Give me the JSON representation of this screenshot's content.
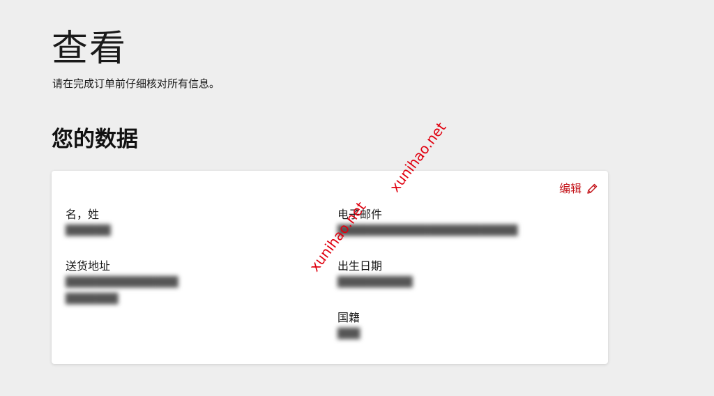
{
  "header": {
    "title": "查看",
    "subtitle": "请在完成订单前仔细核对所有信息。"
  },
  "section": {
    "title": "您的数据"
  },
  "card": {
    "edit_label": "编辑",
    "edit_icon": "pencil-icon",
    "fields": {
      "name": {
        "label": "名，姓",
        "value": "██████"
      },
      "address": {
        "label": "送货地址",
        "line1": "███████████████",
        "line2": "███████"
      },
      "email": {
        "label": "电子邮件",
        "value": "████████████████████████"
      },
      "birthdate": {
        "label": "出生日期",
        "value": "██████████"
      },
      "nationality": {
        "label": "国籍",
        "value": "███"
      }
    }
  },
  "watermarks": {
    "upper": "xunihao.net",
    "lower": "xunihao.net",
    "color": "#e0000f"
  },
  "colors": {
    "accent": "#c4161c",
    "background": "#eeeeee",
    "card": "#ffffff"
  }
}
